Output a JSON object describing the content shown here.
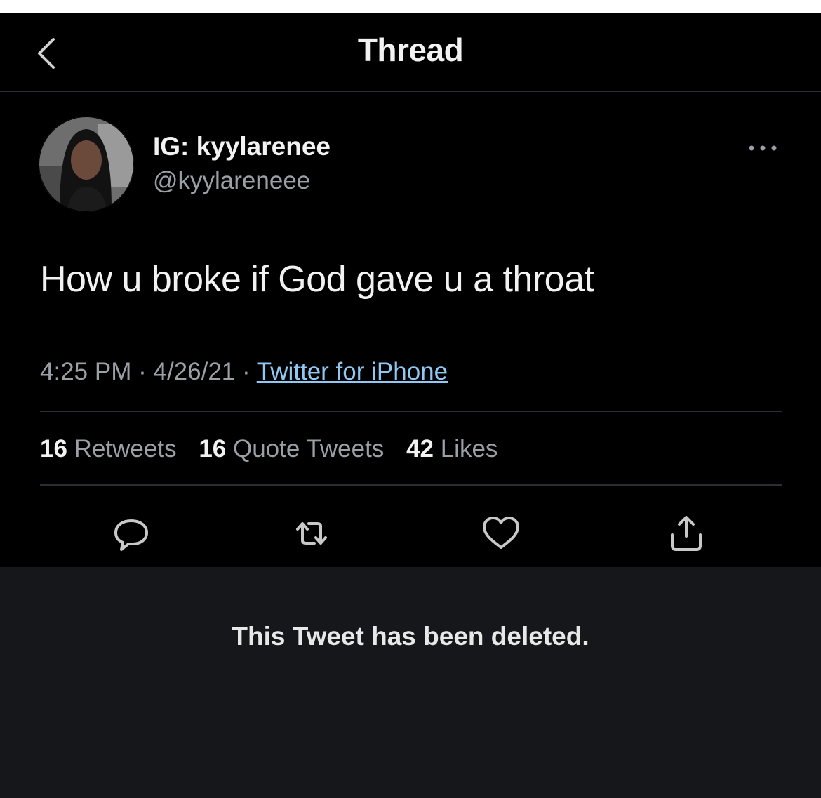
{
  "header": {
    "title": "Thread",
    "back_icon": "chevron-left-icon"
  },
  "tweet": {
    "display_name": "IG: kyylarenee",
    "handle": "@kyylareneee",
    "text": "How u broke if God gave u a throat",
    "time": "4:25 PM",
    "date": "4/26/21",
    "separator": "·",
    "source": "Twitter for iPhone",
    "more_icon": "more-horizontal-icon"
  },
  "stats": {
    "retweets_count": "16",
    "retweets_label": "Retweets",
    "quotes_count": "16",
    "quotes_label": "Quote Tweets",
    "likes_count": "42",
    "likes_label": "Likes"
  },
  "actions": [
    {
      "name": "reply",
      "icon": "reply-bubble-icon"
    },
    {
      "name": "retweet",
      "icon": "retweet-icon"
    },
    {
      "name": "like",
      "icon": "heart-icon"
    },
    {
      "name": "share",
      "icon": "share-icon"
    }
  ],
  "deleted_notice": "This Tweet has been deleted.",
  "colors": {
    "background": "#000000",
    "text": "#f2f2f2",
    "secondary_text": "#9aa0a6",
    "link": "#8fc9f3",
    "deleted_panel": "#16171b"
  }
}
